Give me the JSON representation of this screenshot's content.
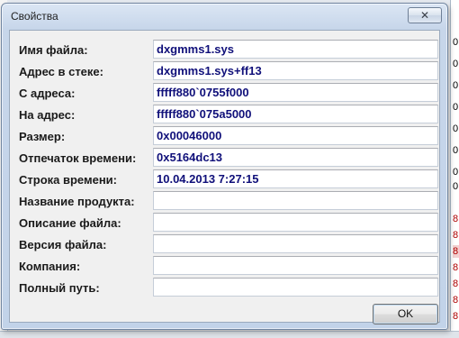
{
  "dialog": {
    "title": "Свойства",
    "close_glyph": "✕",
    "ok_label": "OK"
  },
  "fields": [
    {
      "label": "Имя файла:",
      "value": "dxgmms1.sys"
    },
    {
      "label": "Адрес в стеке:",
      "value": "dxgmms1.sys+ff13"
    },
    {
      "label": "С адреса:",
      "value": "fffff880`0755f000"
    },
    {
      "label": "На адрес:",
      "value": "fffff880`075a5000"
    },
    {
      "label": "Размер:",
      "value": "0x00046000"
    },
    {
      "label": "Отпечаток времени:",
      "value": "0x5164dc13"
    },
    {
      "label": "Строка времени:",
      "value": "10.04.2013 7:27:15"
    },
    {
      "label": "Название продукта:",
      "value": ""
    },
    {
      "label": "Описание файла:",
      "value": ""
    },
    {
      "label": "Версия файла:",
      "value": ""
    },
    {
      "label": "Компания:",
      "value": ""
    },
    {
      "label": "Полный путь:",
      "value": ""
    }
  ],
  "background": {
    "right_column": [
      "0",
      "0",
      "0",
      "0",
      "0",
      "0",
      "0",
      "0",
      "8",
      "8",
      "8",
      "8",
      "8",
      "8",
      "8"
    ]
  }
}
